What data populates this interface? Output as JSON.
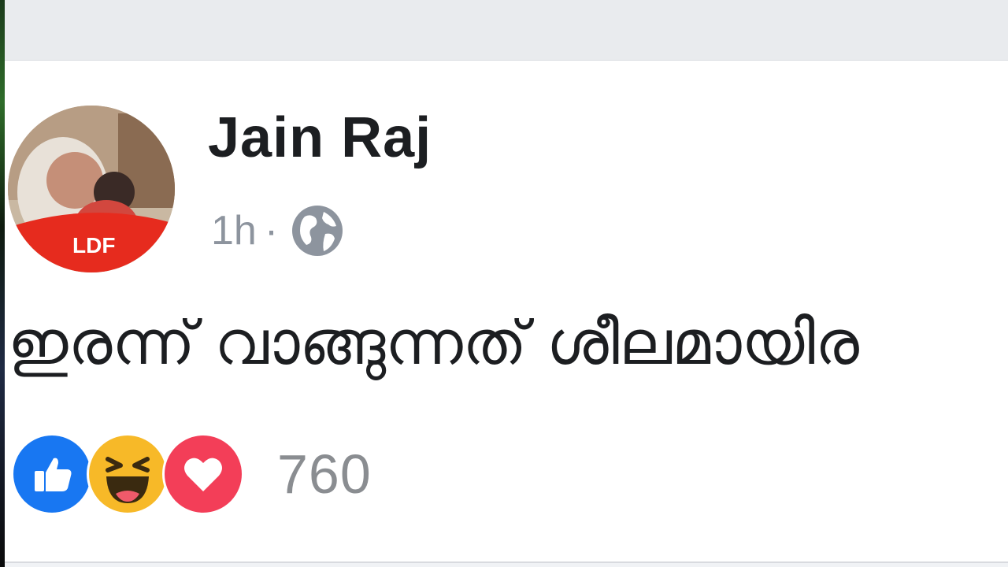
{
  "post": {
    "author": "Jain Raj",
    "time": "1h",
    "separator": "·",
    "privacy_icon": "globe-icon",
    "text": "ഇരന്ന് വാങ്ങുന്നത് ശീലമായിര",
    "avatar_badge": "LDF",
    "reactions": {
      "types": [
        "like-icon",
        "haha-icon",
        "love-icon"
      ],
      "count": "760"
    }
  },
  "colors": {
    "like": "#1877f2",
    "haha": "#f7b928",
    "love": "#f33e58",
    "meta_text": "#8d949e"
  }
}
